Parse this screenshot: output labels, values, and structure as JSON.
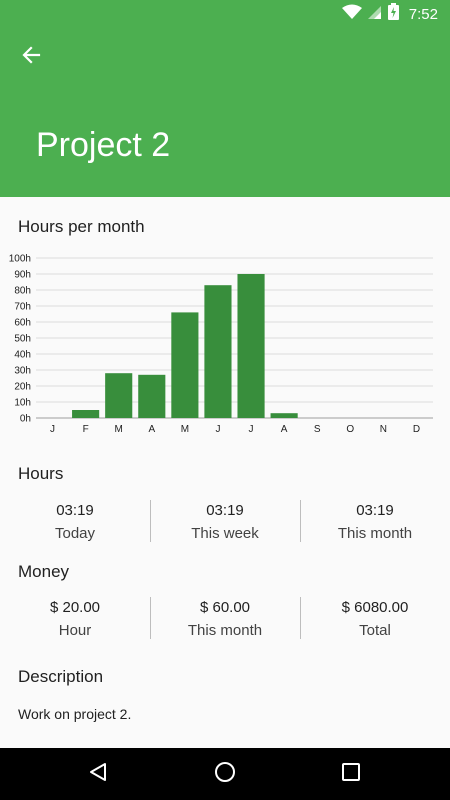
{
  "status_bar": {
    "time": "7:52",
    "icons": [
      "wifi-icon",
      "signal-icon",
      "battery-charging-icon"
    ]
  },
  "app_bar": {
    "back_icon": "arrow-back-icon",
    "title": "Project 2",
    "color": "#4caf50"
  },
  "chart_section": {
    "title": "Hours per month"
  },
  "chart_data": {
    "type": "bar",
    "title": "Hours per month",
    "categories": [
      "J",
      "F",
      "M",
      "A",
      "M",
      "J",
      "J",
      "A",
      "S",
      "O",
      "N",
      "D"
    ],
    "values": [
      0,
      5,
      28,
      27,
      66,
      83,
      90,
      3,
      0,
      0,
      0,
      0
    ],
    "yticks": [
      "0h",
      "10h",
      "20h",
      "30h",
      "40h",
      "50h",
      "60h",
      "70h",
      "80h",
      "90h",
      "100h"
    ],
    "ylim": [
      0,
      100
    ],
    "grid": true,
    "bar_color": "#388e3c"
  },
  "hours": {
    "title": "Hours",
    "items": [
      {
        "value": "03:19",
        "label": "Today"
      },
      {
        "value": "03:19",
        "label": "This week"
      },
      {
        "value": "03:19",
        "label": "This month"
      }
    ]
  },
  "money": {
    "title": "Money",
    "items": [
      {
        "value": "$ 20.00",
        "label": "Hour"
      },
      {
        "value": "$ 60.00",
        "label": "This month"
      },
      {
        "value": "$ 6080.00",
        "label": "Total"
      }
    ]
  },
  "description": {
    "title": "Description",
    "text": "Work on project 2."
  },
  "nav_bar": {
    "icons": [
      "back-triangle-icon",
      "home-circle-icon",
      "recents-square-icon"
    ]
  }
}
